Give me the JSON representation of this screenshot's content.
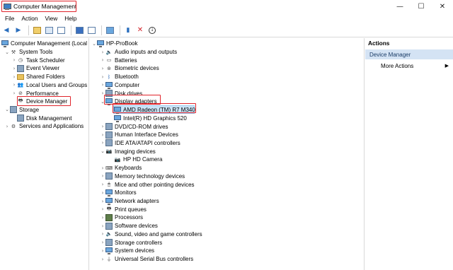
{
  "window": {
    "title": "Computer Management",
    "controls": {
      "minimize": "—",
      "maximize": "☐",
      "close": "✕"
    }
  },
  "menu": [
    "File",
    "Action",
    "View",
    "Help"
  ],
  "toolbar_icons": [
    "back-arrow-icon",
    "forward-arrow-icon",
    "up-folder-icon",
    "console-tree-icon",
    "export-list-icon",
    "help-icon",
    "properties-icon",
    "monitor-icon",
    "update-driver-icon",
    "uninstall-icon",
    "scan-hardware-icon"
  ],
  "left_tree": {
    "root": "Computer Management (Local",
    "items": [
      {
        "label": "System Tools",
        "level": 1,
        "arrow": "⌄"
      },
      {
        "label": "Task Scheduler",
        "level": 2,
        "arrow": "›"
      },
      {
        "label": "Event Viewer",
        "level": 2,
        "arrow": "›"
      },
      {
        "label": "Shared Folders",
        "level": 2,
        "arrow": "›"
      },
      {
        "label": "Local Users and Groups",
        "level": 2,
        "arrow": "›"
      },
      {
        "label": "Performance",
        "level": 2,
        "arrow": "›"
      },
      {
        "label": "Device Manager",
        "level": 2,
        "arrow": ""
      },
      {
        "label": "Storage",
        "level": 1,
        "arrow": "⌄"
      },
      {
        "label": "Disk Management",
        "level": 2,
        "arrow": ""
      },
      {
        "label": "Services and Applications",
        "level": 1,
        "arrow": "›"
      }
    ]
  },
  "device_tree": {
    "root": "HP-ProBook",
    "items": [
      {
        "label": "Audio inputs and outputs",
        "level": 1,
        "arrow": "›"
      },
      {
        "label": "Batteries",
        "level": 1,
        "arrow": "›"
      },
      {
        "label": "Biometric devices",
        "level": 1,
        "arrow": "›"
      },
      {
        "label": "Bluetooth",
        "level": 1,
        "arrow": "›"
      },
      {
        "label": "Computer",
        "level": 1,
        "arrow": "›"
      },
      {
        "label": "Disk drives",
        "level": 1,
        "arrow": "›"
      },
      {
        "label": "Display adapters",
        "level": 1,
        "arrow": "⌄"
      },
      {
        "label": "AMD Radeon (TM) R7 M340",
        "level": 2,
        "arrow": ""
      },
      {
        "label": "Intel(R) HD Graphics 520",
        "level": 2,
        "arrow": ""
      },
      {
        "label": "DVD/CD-ROM drives",
        "level": 1,
        "arrow": "›"
      },
      {
        "label": "Human Interface Devices",
        "level": 1,
        "arrow": "›"
      },
      {
        "label": "IDE ATA/ATAPI controllers",
        "level": 1,
        "arrow": "›"
      },
      {
        "label": "Imaging devices",
        "level": 1,
        "arrow": "⌄"
      },
      {
        "label": "HP HD Camera",
        "level": 2,
        "arrow": ""
      },
      {
        "label": "Keyboards",
        "level": 1,
        "arrow": "›"
      },
      {
        "label": "Memory technology devices",
        "level": 1,
        "arrow": "›"
      },
      {
        "label": "Mice and other pointing devices",
        "level": 1,
        "arrow": "›"
      },
      {
        "label": "Monitors",
        "level": 1,
        "arrow": "›"
      },
      {
        "label": "Network adapters",
        "level": 1,
        "arrow": "›"
      },
      {
        "label": "Print queues",
        "level": 1,
        "arrow": "›"
      },
      {
        "label": "Processors",
        "level": 1,
        "arrow": "›"
      },
      {
        "label": "Software devices",
        "level": 1,
        "arrow": "›"
      },
      {
        "label": "Sound, video and game controllers",
        "level": 1,
        "arrow": "›"
      },
      {
        "label": "Storage controllers",
        "level": 1,
        "arrow": "›"
      },
      {
        "label": "System devices",
        "level": 1,
        "arrow": "›"
      },
      {
        "label": "Universal Serial Bus controllers",
        "level": 1,
        "arrow": "›"
      }
    ]
  },
  "actions": {
    "header": "Actions",
    "selected": "Device Manager",
    "more": "More Actions",
    "more_arrow": "▶"
  },
  "colors": {
    "highlight_border": "#e0242b",
    "selection": "#cce4f7",
    "actions_selection": "#d4e3f4"
  }
}
